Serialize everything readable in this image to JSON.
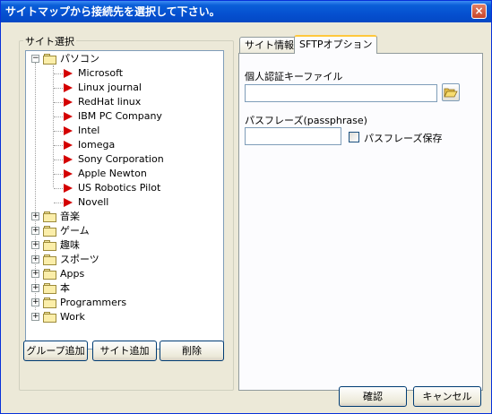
{
  "window": {
    "title": "サイトマップから接続先を選択して下さい。",
    "close_glyph": "×"
  },
  "sidebar": {
    "group_label": "サイト選択",
    "tree": {
      "root": {
        "label": "パソコン",
        "expander": "−"
      },
      "children": [
        "Microsoft",
        "Linux journal",
        "RedHat linux",
        "IBM PC Company",
        "Intel",
        "Iomega",
        "Sony Corporation",
        "Apple Newton",
        "US Robotics Pilot",
        "Novell"
      ],
      "siblings": [
        "音楽",
        "ゲーム",
        "趣味",
        "スポーツ",
        "Apps",
        "本",
        "Programmers",
        "Work"
      ],
      "collapsed_expander": "+"
    },
    "buttons": {
      "add_group": "グループ追加",
      "add_site": "サイト追加",
      "delete": "削除"
    }
  },
  "tabs": {
    "site_info": "サイト情報",
    "sftp_options": "SFTPオプション"
  },
  "sftp": {
    "key_file_label": "個人認証キーファイル",
    "key_file_value": "",
    "passphrase_label": "パスフレーズ(passphrase)",
    "passphrase_value": "",
    "save_passphrase_label": "パスフレーズ保存",
    "save_passphrase_checked": false
  },
  "footer": {
    "ok": "確認",
    "cancel": "キャンセル"
  }
}
